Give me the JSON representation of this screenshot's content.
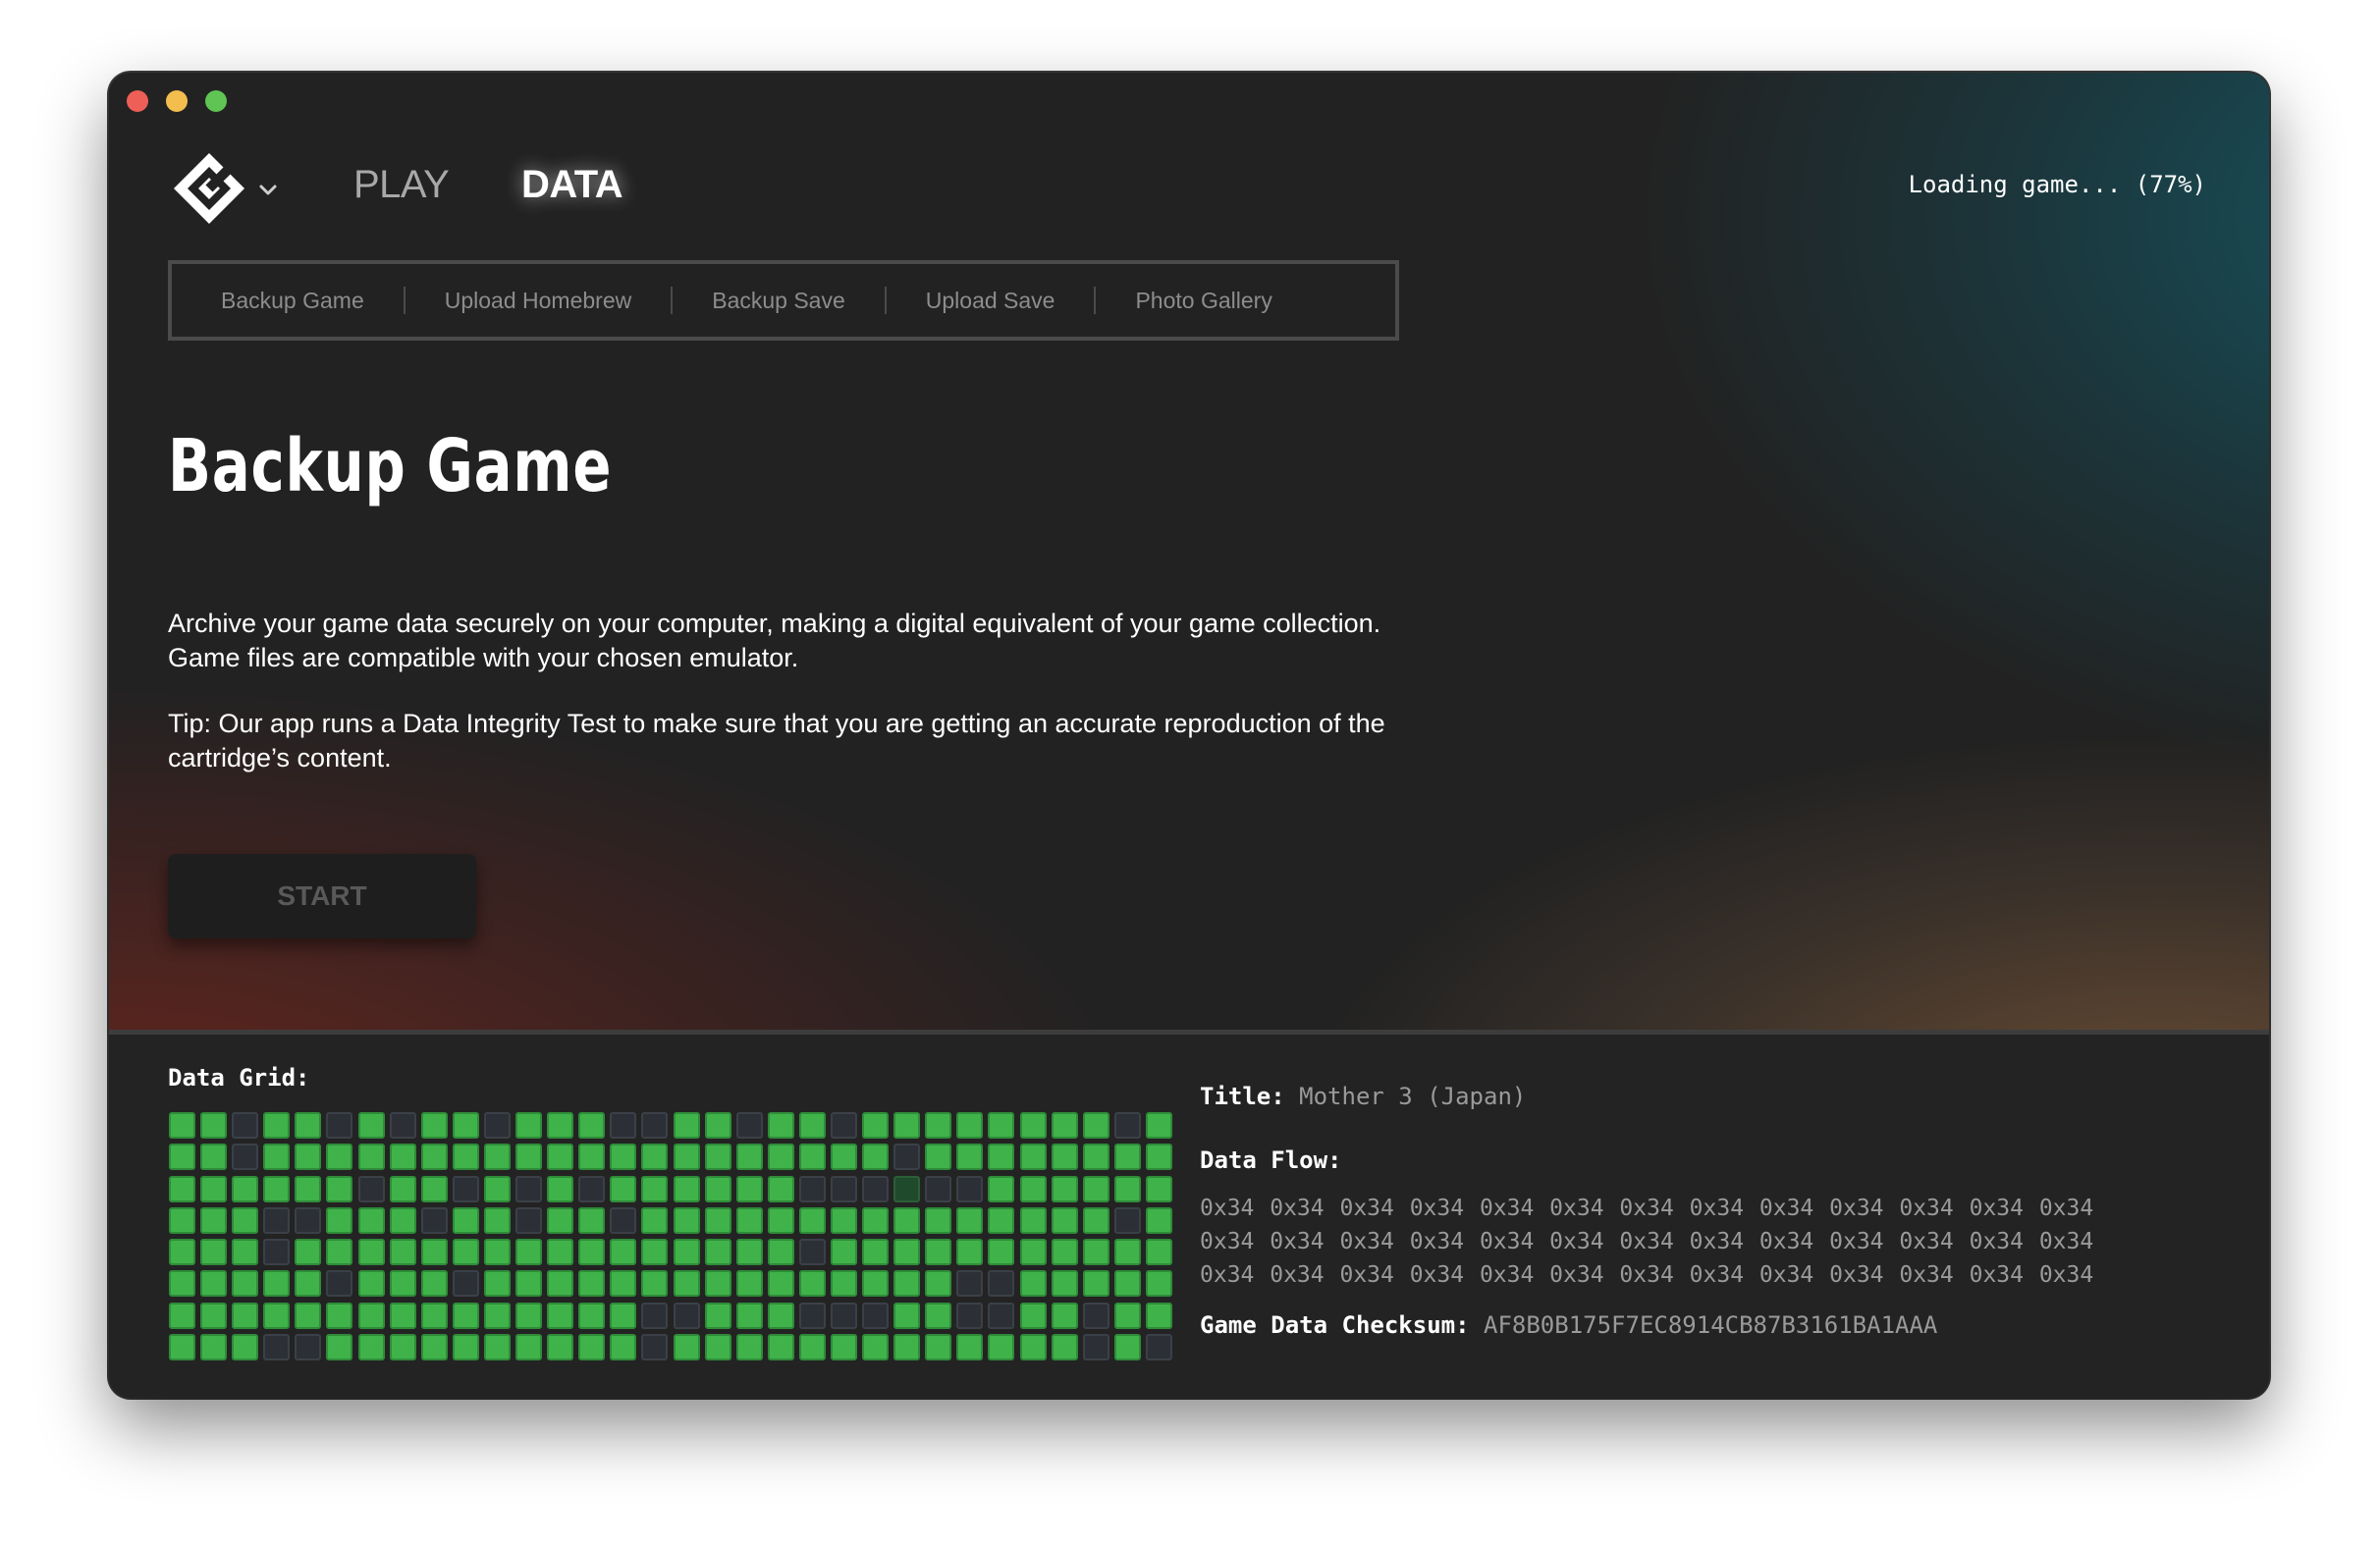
{
  "window": {
    "traffic_lights": [
      "close",
      "minimize",
      "zoom"
    ]
  },
  "header": {
    "logo_icon": "emulator-logo-icon",
    "nav": {
      "play_label": "PLAY",
      "data_label": "DATA"
    },
    "loading_status": "Loading game... (77%)"
  },
  "subnav": {
    "items": [
      {
        "label": "Backup Game"
      },
      {
        "label": "Upload Homebrew"
      },
      {
        "label": "Backup Save"
      },
      {
        "label": "Upload Save"
      },
      {
        "label": "Photo Gallery"
      }
    ]
  },
  "main": {
    "title": "Backup Game",
    "description": "Archive your game data securely on your computer, making a digital equivalent of your game collection. Game files are compatible with your chosen emulator.",
    "tip": "Tip: Our app runs a Data Integrity Test to make sure that you are getting an accurate reproduction of the cartridge’s content.",
    "start_label": "START"
  },
  "data_panel": {
    "grid_label": "Data Grid:",
    "grid_rows": [
      "11011010110111001101101111111101",
      "11011111111111111111111011111111",
      "11111101101010111111000D00111111",
      "11100111011011011111111111111101",
      "11101111111111111111011111111111",
      "11111011101111111111111110011111",
      "11111111111111100111000110011011",
      "11100111111111101111111111111010"
    ],
    "title_label": "Title:",
    "title_value": "Mother 3 (Japan)",
    "flow_label": "Data Flow:",
    "flow_rows": [
      "0x34 0x34 0x34 0x34 0x34 0x34 0x34 0x34 0x34 0x34 0x34 0x34 0x34",
      "0x34 0x34 0x34 0x34 0x34 0x34 0x34 0x34 0x34 0x34 0x34 0x34 0x34",
      "0x34 0x34 0x34 0x34 0x34 0x34 0x34 0x34 0x34 0x34 0x34 0x34 0x34"
    ],
    "checksum_label": "Game Data Checksum:",
    "checksum_value": "AF8B0B175F7EC8914CB87B3161BA1AAA"
  },
  "colors": {
    "cell_on": "#3fb34a",
    "cell_off": "#2c3036",
    "accent_teal": "#165864",
    "accent_red": "#6e261e"
  }
}
